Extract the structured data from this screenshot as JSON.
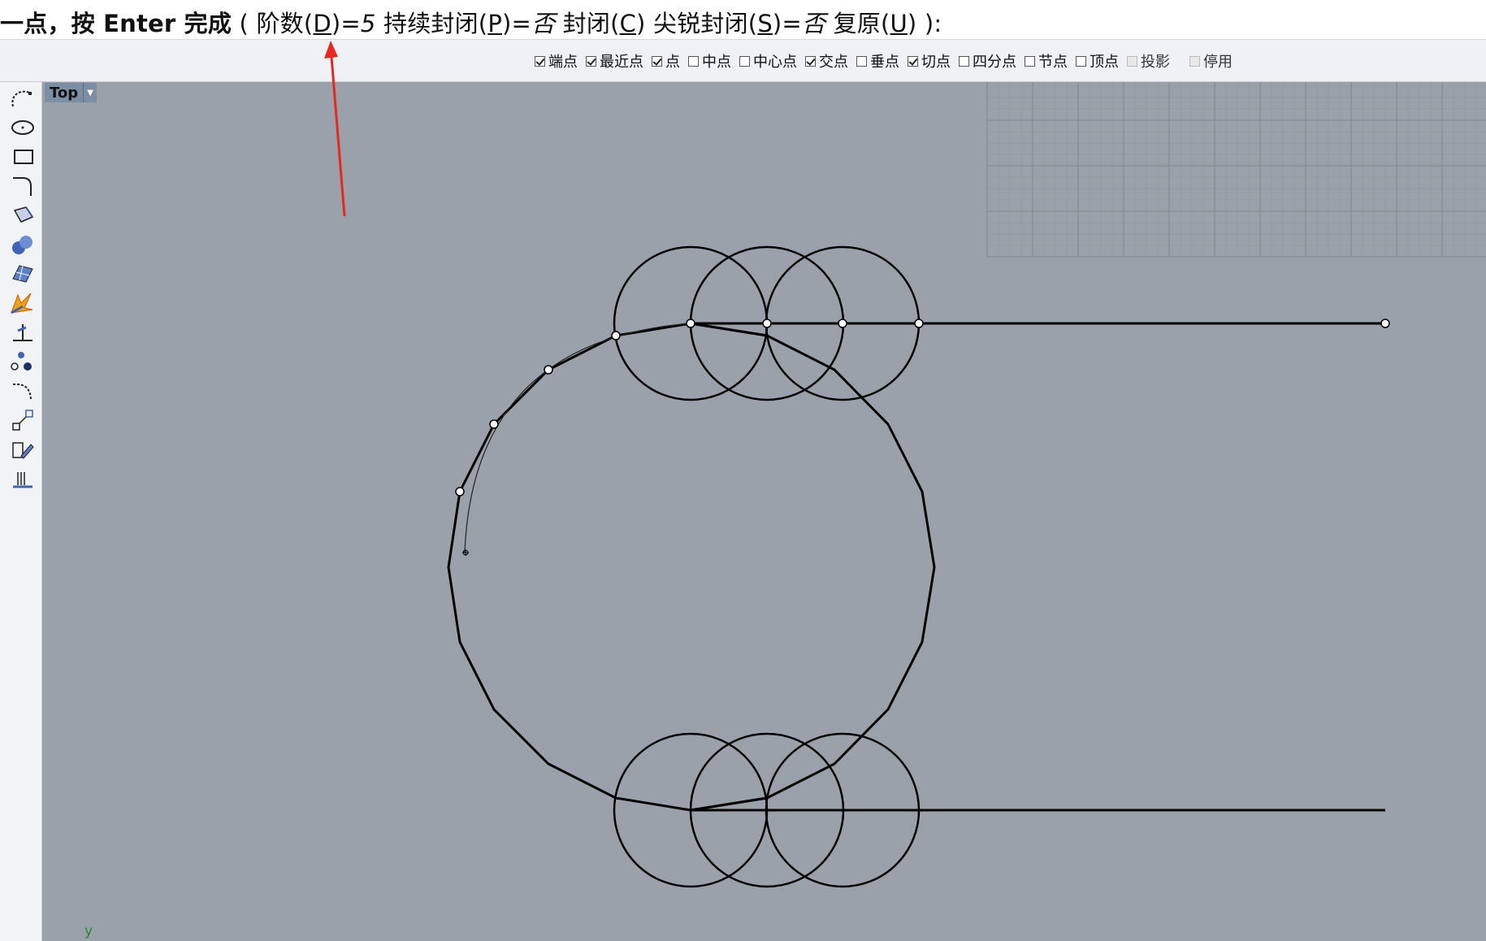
{
  "command": {
    "prompt_bold": "一点，按 Enter 完成",
    "open_paren": "(",
    "degree_label": "阶数(",
    "degree_key": "D",
    "degree_close": ")=",
    "degree_value": "5",
    "persist_label": "持续封闭(",
    "persist_key": "P",
    "persist_close": ")=",
    "persist_value": "否",
    "close_label": "封闭(",
    "close_key": "C",
    "close_close": ")",
    "sharp_label": "尖锐封闭(",
    "sharp_key": "S",
    "sharp_close": ")=",
    "sharp_value": "否",
    "undo_label": "复原(",
    "undo_key": "U",
    "undo_close": ")",
    "end": "):"
  },
  "osnaps": [
    {
      "label": "端点",
      "checked": true,
      "enabled": true
    },
    {
      "label": "最近点",
      "checked": true,
      "enabled": true
    },
    {
      "label": "点",
      "checked": true,
      "enabled": true
    },
    {
      "label": "中点",
      "checked": false,
      "enabled": true
    },
    {
      "label": "中心点",
      "checked": false,
      "enabled": true
    },
    {
      "label": "交点",
      "checked": true,
      "enabled": true
    },
    {
      "label": "垂点",
      "checked": false,
      "enabled": true
    },
    {
      "label": "切点",
      "checked": true,
      "enabled": true
    },
    {
      "label": "四分点",
      "checked": false,
      "enabled": true
    },
    {
      "label": "节点",
      "checked": false,
      "enabled": true
    },
    {
      "label": "顶点",
      "checked": false,
      "enabled": true
    },
    {
      "label": "投影",
      "checked": false,
      "enabled": false
    },
    {
      "label": "停用",
      "checked": false,
      "enabled": false
    }
  ],
  "viewport": {
    "name": "Top",
    "axis_label": "y"
  },
  "toolbar_icons": [
    "curve-icon",
    "ellipse-icon",
    "rectangle-icon",
    "fillet-curve-icon",
    "surface-icon",
    "solid-spheres-icon",
    "mesh-plane-icon",
    "explode-icon",
    "dimension-icon",
    "point-cloud-icon",
    "arc-blend-icon",
    "transform-icon",
    "edit-icon",
    "analysis-icon"
  ],
  "colors": {
    "viewport_bg": "#9aa1aa",
    "curve": "#000000",
    "arrow": "#e8281f",
    "axis_y": "#1e8a2e"
  }
}
